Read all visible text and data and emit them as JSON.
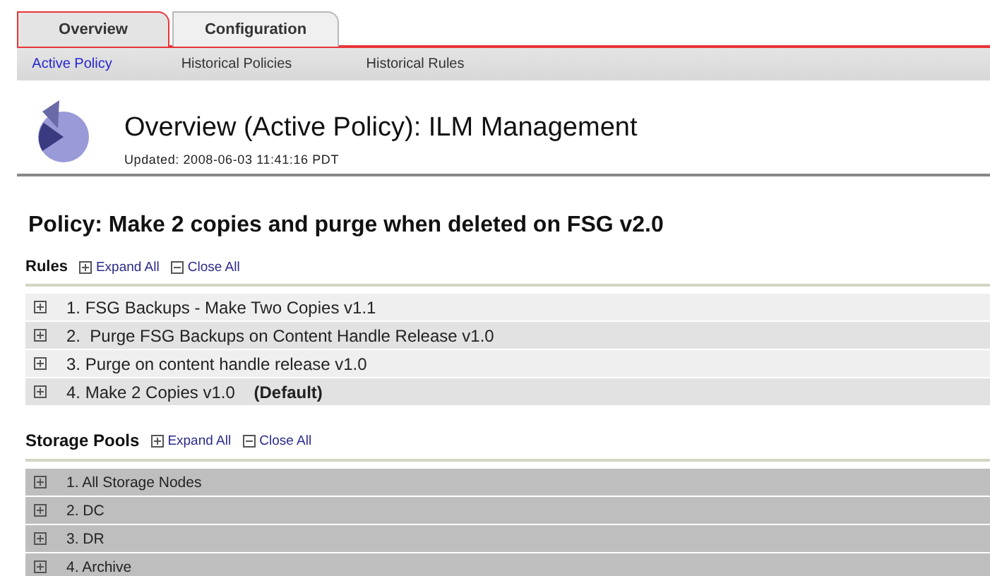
{
  "tabs": [
    {
      "label": "Overview",
      "selected": true
    },
    {
      "label": "Configuration",
      "selected": false
    }
  ],
  "subnav": [
    {
      "label": "Active Policy",
      "selected": true
    },
    {
      "label": "Historical Policies",
      "selected": false
    },
    {
      "label": "Historical Rules",
      "selected": false
    }
  ],
  "header": {
    "title": "Overview (Active Policy): ILM Management",
    "updated": "Updated: 2008-06-03 11:41:16 PDT"
  },
  "policy_title": "Policy: Make 2 copies and purge when deleted on FSG v2.0",
  "sections": [
    {
      "kind": "rules",
      "title": "Rules",
      "expand_all": "Expand All",
      "close_all": "Close All",
      "items": [
        {
          "label": "1. FSG Backups - Make Two Copies v1.1",
          "expanded": false
        },
        {
          "label": "2.  Purge FSG Backups on Content Handle Release v1.0",
          "expanded": false
        },
        {
          "label": "3. Purge on content handle release v1.0",
          "expanded": false
        },
        {
          "label": "4. Make 2 Copies v1.0    **(Default)**",
          "expanded": false
        }
      ]
    },
    {
      "kind": "pools",
      "title": "Storage Pools",
      "expand_all": "Expand All",
      "close_all": "Close All",
      "items": [
        {
          "label": "1. All Storage Nodes",
          "expanded": false
        },
        {
          "label": "2. DC",
          "expanded": false
        },
        {
          "label": "3. DR",
          "expanded": false
        },
        {
          "label": "4. Archive",
          "expanded": false
        }
      ]
    }
  ]
}
